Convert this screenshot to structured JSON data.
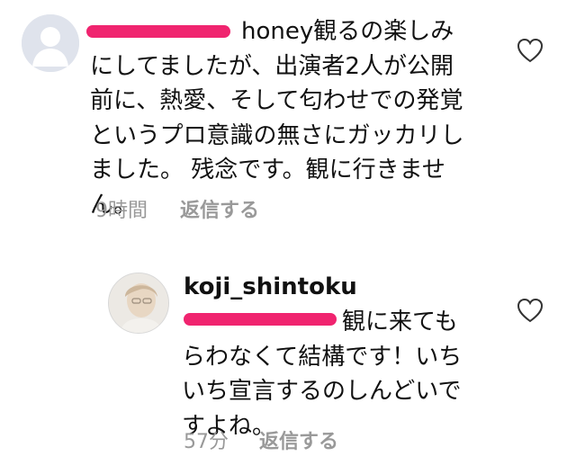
{
  "comments": [
    {
      "text": "honey観るの楽しみ\nにしてましたが、出演者2人が公開\n前に、熱愛、そして匂わせでの発覚\nというプロ意識の無さにガッカリし\nました。 残念です。観に行きませ\nん。",
      "time": "9時間",
      "reply_label": "返信する",
      "avatar_icon": "default-avatar-icon",
      "like_icon": "heart-outline-icon"
    }
  ],
  "reply": {
    "username": "koji_shintoku",
    "text": "観に来ても\nらわなくて結構です！いち\nいち宣言するのしんどいで\nすよね。",
    "time": "57分",
    "reply_label": "返信する",
    "avatar_icon": "profile-photo-avatar",
    "like_icon": "heart-outline-icon"
  },
  "colors": {
    "redaction": "#f0246f",
    "meta_text": "#999999",
    "text": "#111111"
  }
}
